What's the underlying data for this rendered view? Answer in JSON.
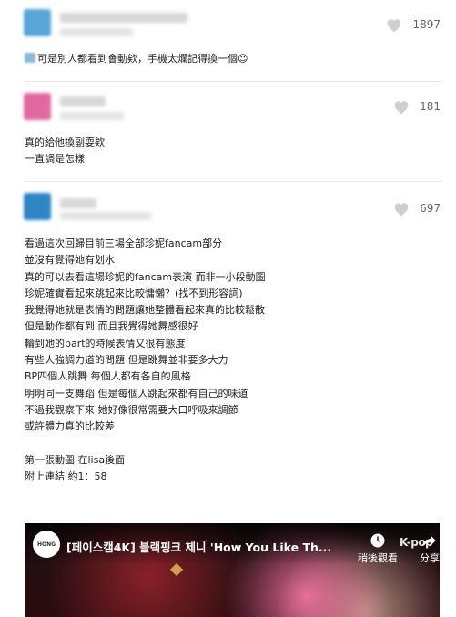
{
  "comments": [
    {
      "likes": "1897",
      "lines": [
        "可是別人都看到會動欸，手機太爛記得換一個☺"
      ]
    },
    {
      "likes": "181",
      "lines": [
        "真的給他換副耍欸",
        "一直調是怎樣"
      ]
    },
    {
      "likes": "697",
      "lines": [
        "看過這次回歸目前三場全部珍妮fancam部分",
        "並沒有覺得她有划水",
        "真的可以去看這場珍妮的fancam表演 而非一小段動圖",
        "珍妮確實看起來跳起來比較慵懶？(找不到形容詞)",
        "我覺得她就是表情的問題讓她整體看起來真的比較鬆散",
        "但是動作都有到 而且我覺得她舞感很好",
        "輪到她的part的時候表情又很有態度",
        "有些人強調力道的問題 但是跳舞並非要多大力",
        "BP四個人跳舞 每個人都有各自的風格",
        "明明同一支舞蹈 但是每個人跳起來都有自己的味道",
        "不過我觀察下來 她好像很常需要大口呼吸來調節",
        "或許體力真的比較差",
        "",
        "第一張動圖 在lisa後面",
        "附上連結 約1：58"
      ]
    }
  ],
  "video": {
    "title": "[페이스캠4K] 블랙핑크 제니 'How You Like Th...",
    "watch_later": "稍後觀看",
    "share": "分享",
    "channel_badge": "HONG",
    "watermark": "K-pop"
  },
  "colors": {
    "avatar1": "#5aa6d9",
    "avatar2": "#e06aa0",
    "avatar3": "#2e86c6",
    "heart": "#cfcfcf"
  }
}
